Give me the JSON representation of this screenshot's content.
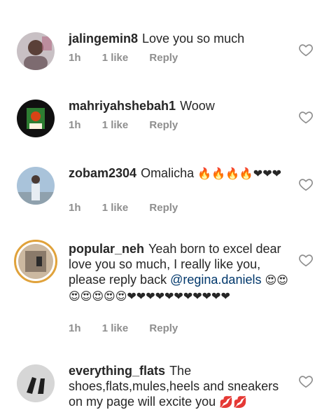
{
  "comments": [
    {
      "username": "jalingemin8",
      "text": "Love you so much",
      "time": "1h",
      "likes": "1 like",
      "reply": "Reply"
    },
    {
      "username": "mahriyahshebah1",
      "text": "Woow",
      "time": "1h",
      "likes": "1 like",
      "reply": "Reply"
    },
    {
      "username": "zobam2304",
      "text": "Omalicha",
      "emoji": "🔥🔥🔥🔥❤❤❤",
      "time": "1h",
      "likes": "1 like",
      "reply": "Reply"
    },
    {
      "username": "popular_neh",
      "text": "Yeah born to excel dear love you so much, I really like you, please reply back",
      "mention": "@regina.daniels",
      "emoji": "😍😍😍😍😍😍😍❤❤❤❤❤❤❤❤❤❤❤",
      "time": "1h",
      "likes": "1 like",
      "reply": "Reply"
    },
    {
      "username": "everything_flats",
      "text": "The shoes,flats,mules,heels and sneakers on my page will excite you",
      "emoji": "💋💋"
    }
  ],
  "icons": {
    "like": "heart-outline-icon"
  }
}
